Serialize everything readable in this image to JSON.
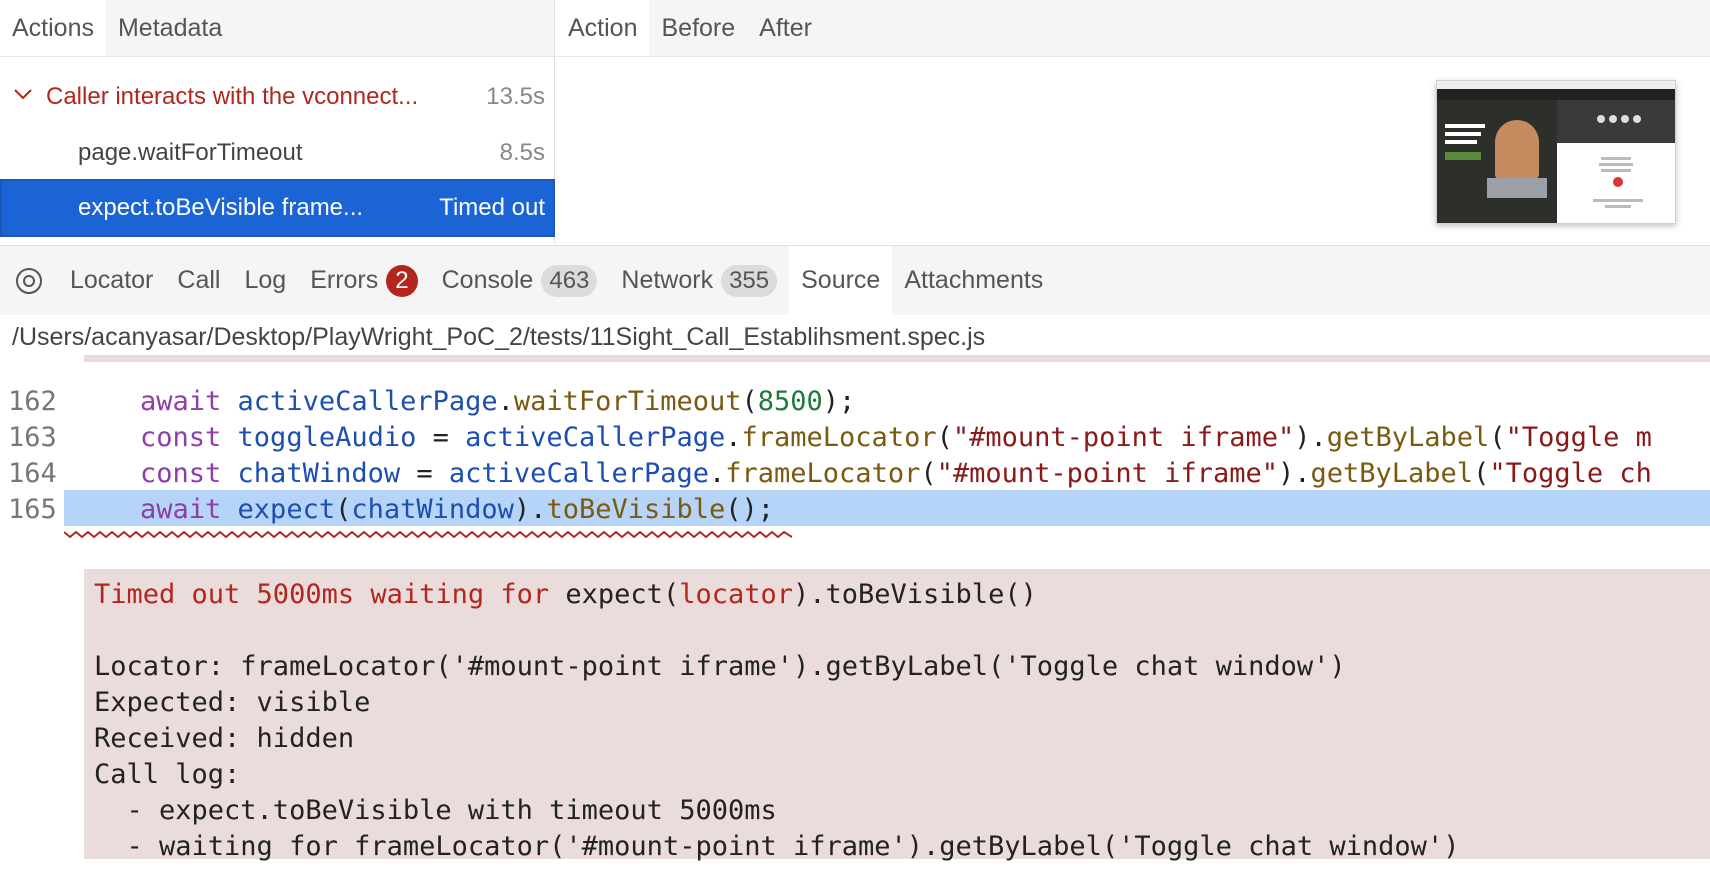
{
  "left_tabs": [
    "Actions",
    "Metadata"
  ],
  "right_tabs": [
    "Action",
    "Before",
    "After"
  ],
  "actions": [
    {
      "name": "Caller interacts with the vconnect...",
      "duration": "13.5s"
    },
    {
      "name": "page.waitForTimeout",
      "duration": "8.5s"
    },
    {
      "name": "expect.toBeVisible frame...",
      "duration": "Timed out"
    }
  ],
  "bottom_tabs": {
    "locator": "Locator",
    "call": "Call",
    "log": "Log",
    "errors": "Errors",
    "errors_count": "2",
    "console": "Console",
    "console_count": "463",
    "network": "Network",
    "network_count": "355",
    "source": "Source",
    "attachments": "Attachments"
  },
  "file_path": "/Users/acanyasar/Desktop/PlayWright_PoC_2/tests/11Sight_Call_Establihsment.spec.js",
  "source_lines": {
    "l162": {
      "n": "162"
    },
    "l163": {
      "n": "163"
    },
    "l164": {
      "n": "164"
    },
    "l165": {
      "n": "165"
    }
  },
  "error": {
    "line1_a": "Timed out 5000ms waiting for ",
    "line1_b": "expect(",
    "line1_c": "locator",
    "line1_d": ").toBeVisible()",
    "locator": "Locator: frameLocator('#mount-point iframe').getByLabel('Toggle chat window')",
    "expected": "Expected: visible",
    "received": "Received: hidden",
    "call_log": "Call log:",
    "log1": "  - expect.toBeVisible with timeout 5000ms",
    "log2": "  - waiting for frameLocator('#mount-point iframe').getByLabel('Toggle chat window')"
  },
  "colors": {
    "accent": "#1a64d6",
    "error": "#b3261e",
    "error_bg": "#ebdcdc",
    "highlight": "#b6d4f7"
  }
}
